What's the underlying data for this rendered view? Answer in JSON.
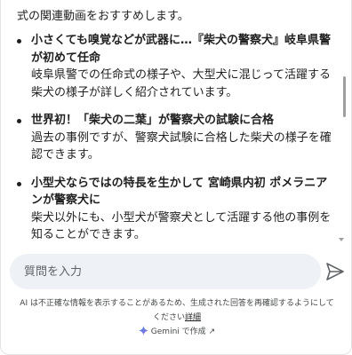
{
  "intro_text": "式の関連動画をおすすめします。",
  "results": [
    {
      "title": "小さくても嗅覚などが武器に…『柴犬の警察犬』岐阜県警が初めて任命",
      "description": "岐阜県警での任命式の様子や、大型犬に混じって活躍する柴犬の様子が詳しく紹介されています。"
    },
    {
      "title": "世界初！「柴犬の二葉」が警察犬の試験に合格",
      "description": "過去の事例ですが、警察犬試験に合格した柴犬の様子を確認できます。"
    },
    {
      "title": "小型犬ならではの特長を生かして 宮崎県内初 ポメラニアンが警察犬に",
      "description": "柴犬以外にも、小型犬が警察犬として活躍する他の事例を知ることができます。"
    }
  ],
  "input": {
    "placeholder": "質問を入力",
    "value": ""
  },
  "disclaimer": {
    "text": "AI は不正確な情報を表示することがあるため、生成された回答を再確認するようにしてください",
    "link_label": "詳細"
  },
  "footer": {
    "label": "Gemini で作成",
    "arrow": "↗"
  },
  "colors": {
    "accent_gemini_1": "#4285f4",
    "accent_gemini_2": "#9b72cb",
    "input_bg": "#eef1f6"
  },
  "icons": {
    "send": "send-icon",
    "gemini": "gemini-sparkle-icon"
  }
}
